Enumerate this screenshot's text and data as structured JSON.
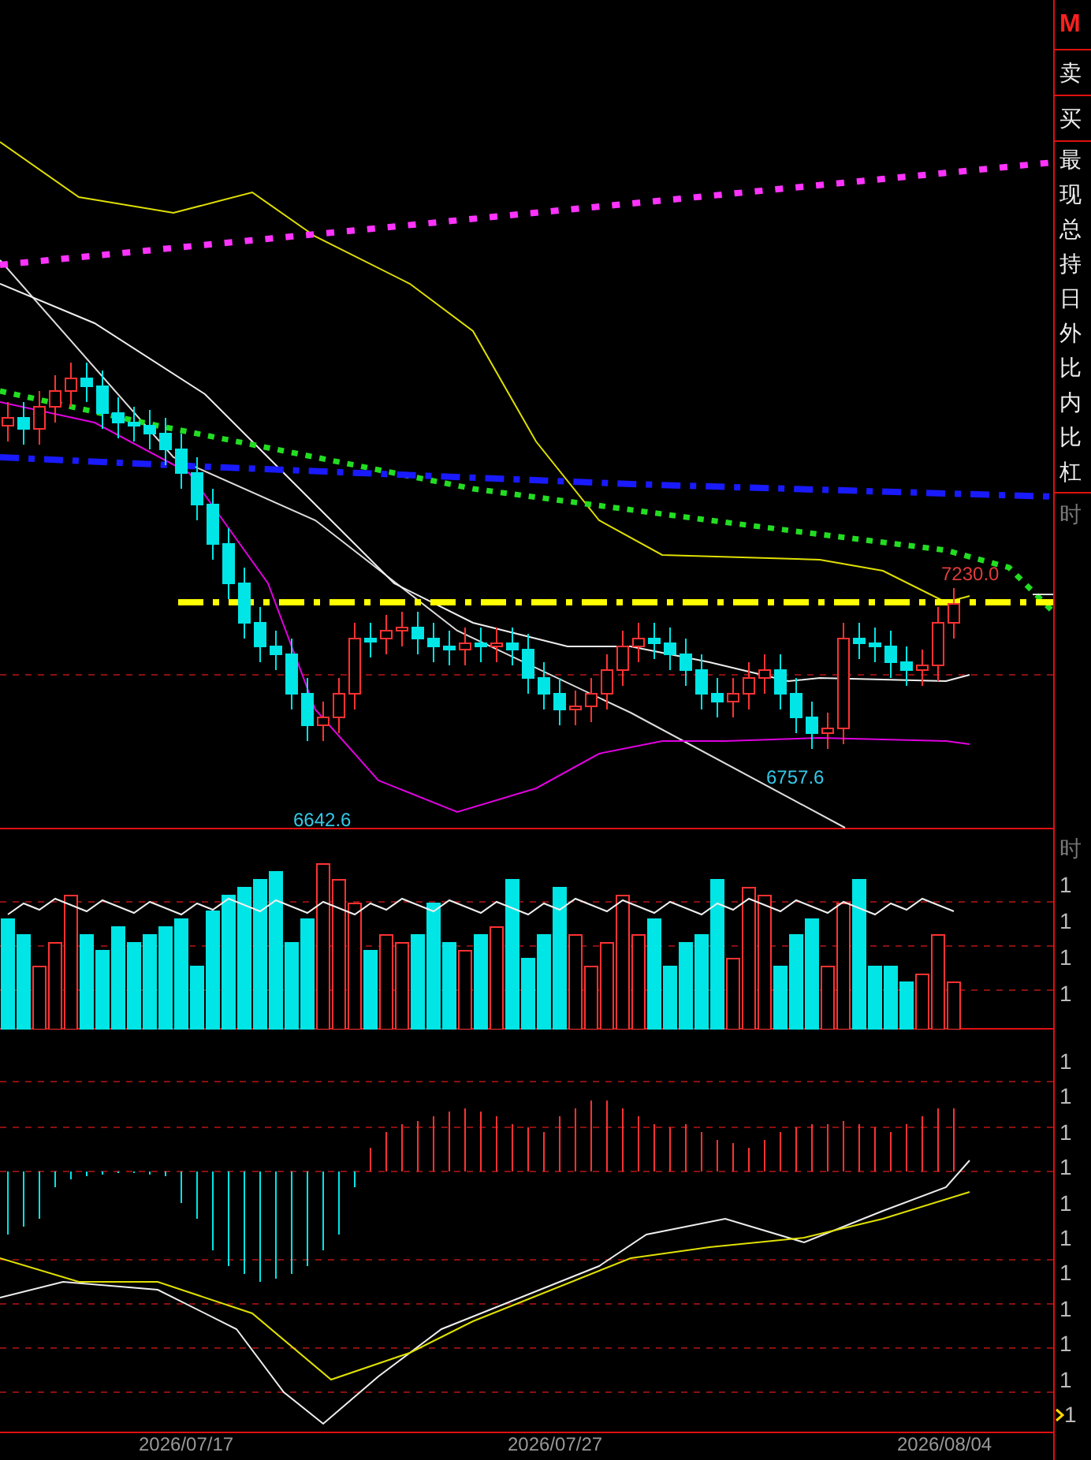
{
  "side_panel": {
    "header": "M",
    "quotes": [
      "卖",
      "买"
    ],
    "fields": [
      "最",
      "现",
      "总",
      "持",
      "日",
      "外",
      "比",
      "内",
      "比",
      "杠"
    ],
    "section": "时"
  },
  "price_chart": {
    "labels": [
      {
        "text": "7230.0",
        "kind": "high"
      },
      {
        "text": "6757.6",
        "kind": "low"
      },
      {
        "text": "6642.6",
        "kind": "low"
      }
    ]
  },
  "volume_axis": {
    "title": "时",
    "ticks": [
      "1",
      "1",
      "1",
      "1"
    ]
  },
  "macd_axis": {
    "ticks": [
      "1",
      "1",
      "1",
      "1",
      "1",
      "1",
      "1",
      "1",
      "1",
      "1",
      "1"
    ]
  },
  "date_axis": [
    "2026/07/17",
    "2026/07/27",
    "2026/08/04"
  ]
}
